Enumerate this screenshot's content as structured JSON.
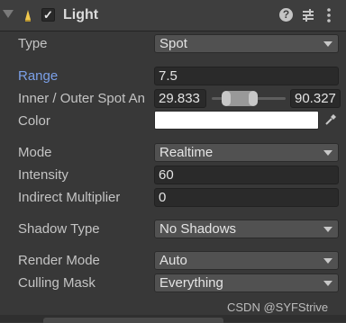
{
  "component": {
    "title": "Light",
    "enabled_mark": "✓",
    "help_glyph": "?"
  },
  "fields": {
    "type": {
      "label": "Type",
      "value": "Spot"
    },
    "range": {
      "label": "Range",
      "value": "7.5"
    },
    "spot_angle": {
      "label": "Inner / Outer Spot An",
      "inner": "29.833",
      "outer": "90.327"
    },
    "color": {
      "label": "Color",
      "value": "#ffffff"
    },
    "mode": {
      "label": "Mode",
      "value": "Realtime"
    },
    "intensity": {
      "label": "Intensity",
      "value": "60"
    },
    "indirect_multiplier": {
      "label": "Indirect Multiplier",
      "value": "0"
    },
    "shadow_type": {
      "label": "Shadow Type",
      "value": "No Shadows"
    },
    "render_mode": {
      "label": "Render Mode",
      "value": "Auto"
    },
    "culling_mask": {
      "label": "Culling Mask",
      "value": "Everything"
    }
  },
  "watermark": "CSDN @SYFStrive",
  "colors": {
    "background": "#383838",
    "header": "#3e3e3e",
    "highlight_label": "#7ba0e8",
    "field": "#2a2a2a",
    "dropdown": "#515151"
  },
  "icons": {
    "foldout": "foldout-arrow-icon",
    "light": "light-bulb-icon",
    "help": "help-icon",
    "preset": "preset-sliders-icon",
    "menu": "kebab-menu-icon",
    "eyedropper": "eyedropper-icon",
    "dropdown": "chevron-down-icon"
  }
}
